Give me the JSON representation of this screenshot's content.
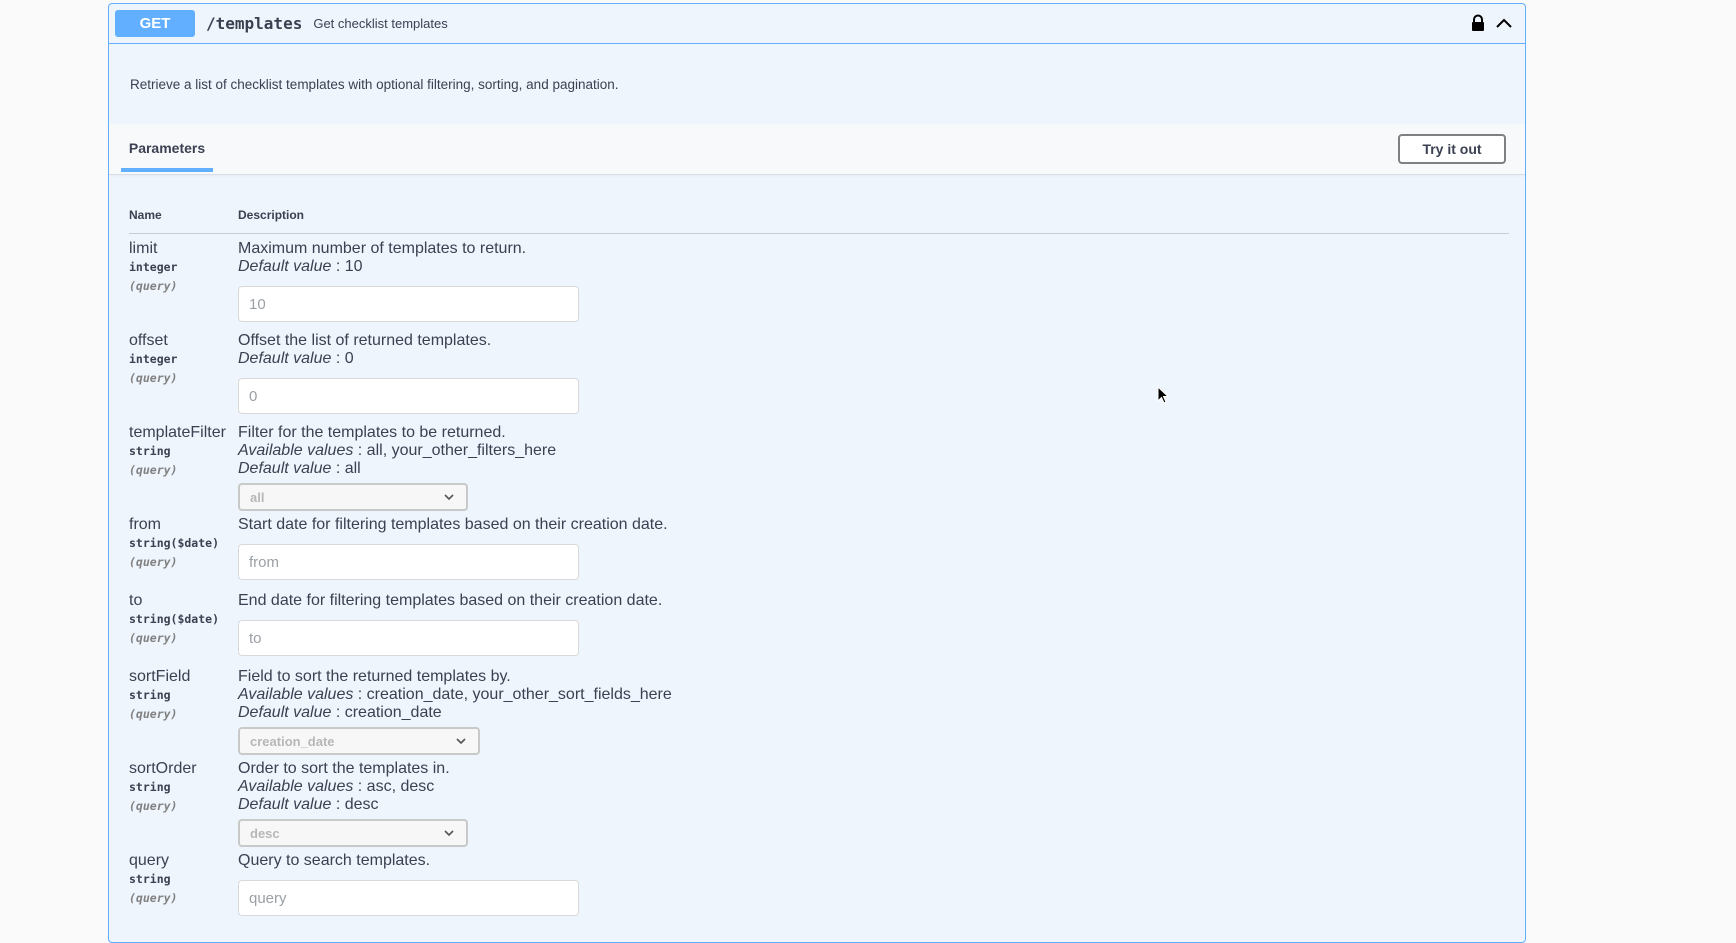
{
  "operation": {
    "method": "GET",
    "path": "/templates",
    "summary": "Get checklist templates",
    "description": "Retrieve a list of checklist templates with optional filtering, sorting, and pagination."
  },
  "section": {
    "tab_label": "Parameters",
    "try_button_label": "Try it out"
  },
  "table": {
    "name_header": "Name",
    "description_header": "Description"
  },
  "labels": {
    "default_value": "Default value",
    "available_values": "Available values"
  },
  "params": [
    {
      "name": "limit",
      "type": "integer",
      "in": "(query)",
      "description": "Maximum number of templates to return.",
      "default": " : 10",
      "input_value": "10"
    },
    {
      "name": "offset",
      "type": "integer",
      "in": "(query)",
      "description": "Offset the list of returned templates.",
      "default": " : 0",
      "input_value": "0"
    },
    {
      "name": "templateFilter",
      "type": "string",
      "in": "(query)",
      "description": "Filter for the templates to be returned.",
      "available": " : all, your_other_filters_here",
      "default": " : all",
      "selected": "all"
    },
    {
      "name": "from",
      "type": "string($date)",
      "in": "(query)",
      "description": "Start date for filtering templates based on their creation date.",
      "placeholder": "from"
    },
    {
      "name": "to",
      "type": "string($date)",
      "in": "(query)",
      "description": "End date for filtering templates based on their creation date.",
      "placeholder": "to"
    },
    {
      "name": "sortField",
      "type": "string",
      "in": "(query)",
      "description": "Field to sort the returned templates by.",
      "available": " : creation_date, your_other_sort_fields_here",
      "default": " : creation_date",
      "selected": "creation_date"
    },
    {
      "name": "sortOrder",
      "type": "string",
      "in": "(query)",
      "description": "Order to sort the templates in.",
      "available": " : asc, desc",
      "default": " : desc",
      "selected": "desc"
    },
    {
      "name": "query",
      "type": "string",
      "in": "(query)",
      "description": "Query to search templates.",
      "placeholder": "query"
    }
  ],
  "colors": {
    "get_accent": "#61affe",
    "block_background": "#eef5fd",
    "page_background": "#fafafa"
  }
}
